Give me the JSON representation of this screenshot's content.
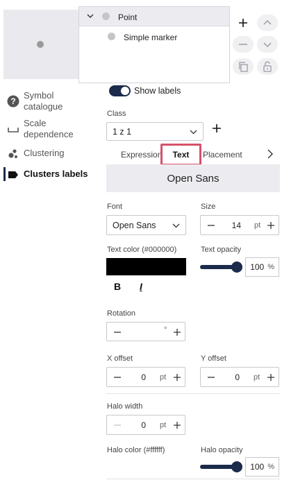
{
  "layer_tree": {
    "parent_label": "Point",
    "child_label": "Simple marker"
  },
  "nav": {
    "items": [
      {
        "label_line1": "Symbol",
        "label_line2": "catalogue"
      },
      {
        "label_line1": "Scale",
        "label_line2": "dependence"
      },
      {
        "label_line1": "Clustering",
        "label_line2": ""
      },
      {
        "label_line1": "Clusters labels",
        "label_line2": ""
      }
    ]
  },
  "show_labels": {
    "label": "Show labels",
    "checked": true
  },
  "class_field": {
    "label": "Class",
    "value": "1 z 1"
  },
  "tabs": {
    "items": [
      "Expression",
      "Text",
      "Placement"
    ],
    "active": "Text"
  },
  "font_preview": "Open Sans",
  "font": {
    "label": "Font",
    "value": "Open Sans"
  },
  "size": {
    "label": "Size",
    "value": "14",
    "unit": "pt"
  },
  "text_color": {
    "label": "Text color (#000000)",
    "hex": "#000000"
  },
  "text_opacity": {
    "label": "Text opacity",
    "value": "100",
    "unit": "%",
    "level": 1.0
  },
  "style_buttons": {
    "bold": "B",
    "italic": "I"
  },
  "rotation": {
    "label": "Rotation",
    "value": "",
    "unit": "°"
  },
  "x_offset": {
    "label": "X offset",
    "value": "0",
    "unit": "pt"
  },
  "y_offset": {
    "label": "Y offset",
    "value": "0",
    "unit": "pt"
  },
  "halo_width": {
    "label": "Halo width",
    "value": "0",
    "unit": "pt"
  },
  "halo_color": {
    "label": "Halo color (#ffffff)",
    "hex": "#ffffff"
  },
  "halo_opacity": {
    "label": "Halo opacity",
    "value": "100",
    "unit": "%",
    "level": 1.0
  },
  "colors": {
    "accent": "#1b2b4b",
    "highlight": "#d6506a"
  }
}
